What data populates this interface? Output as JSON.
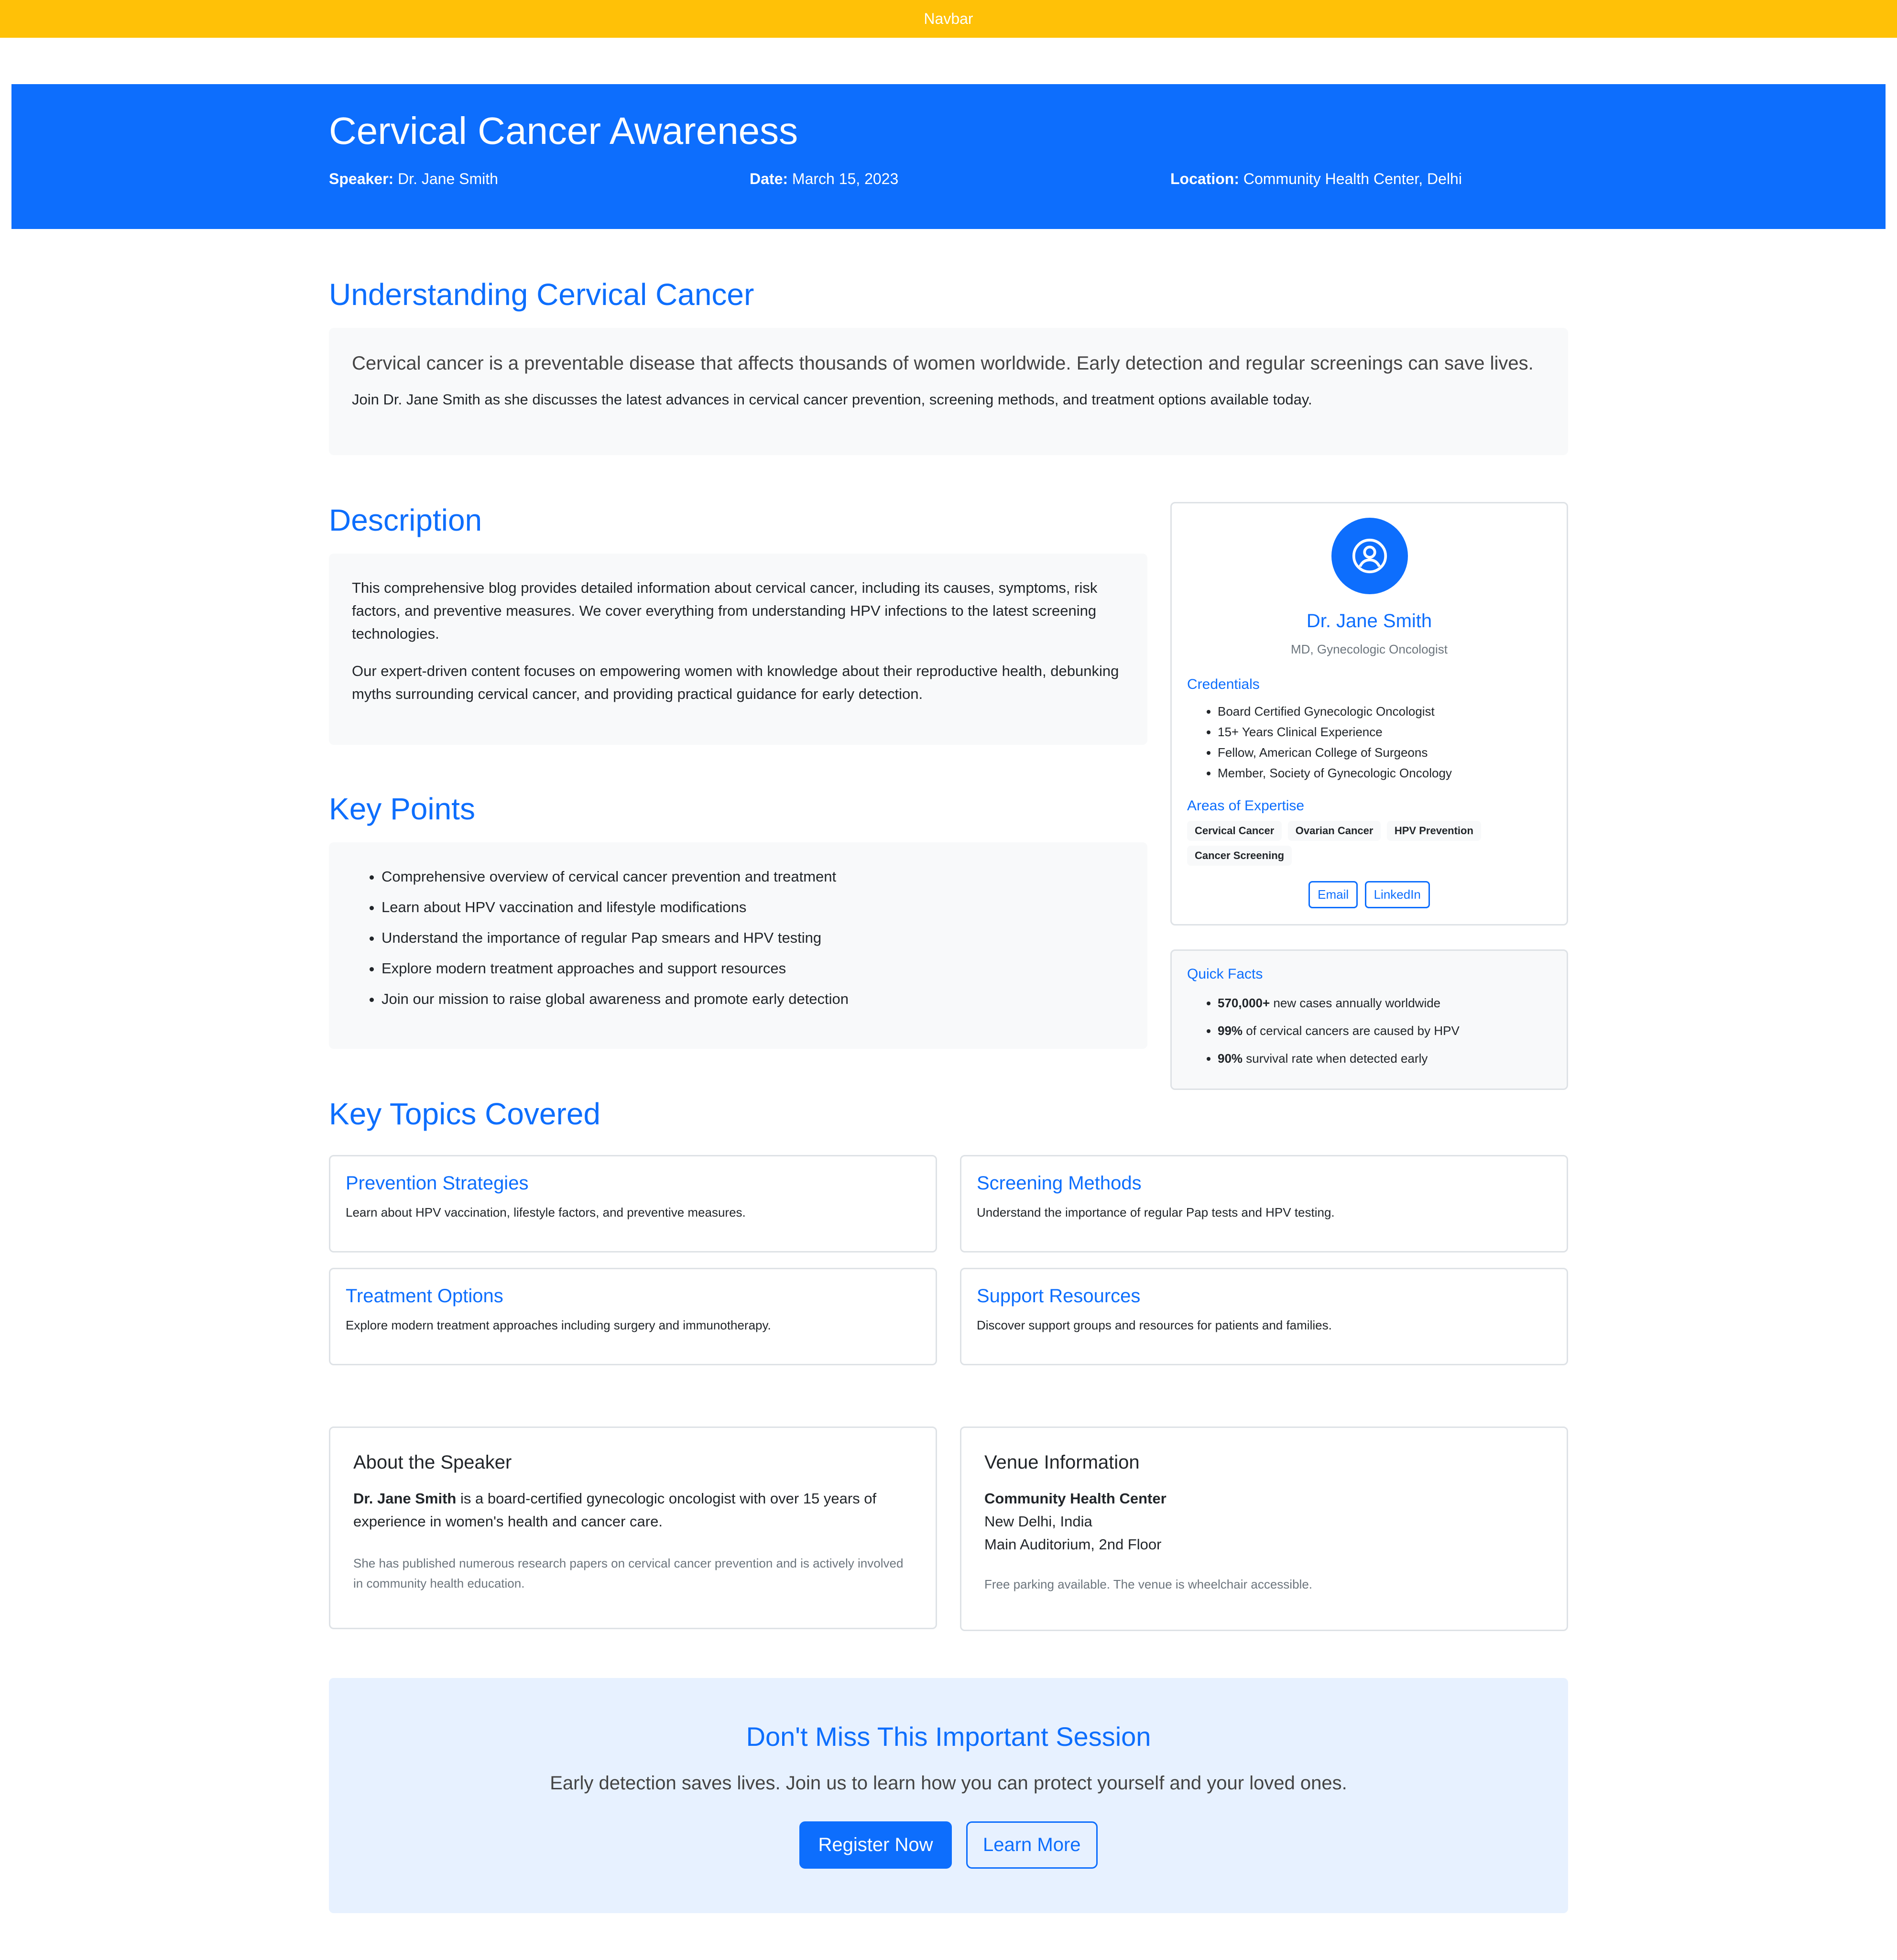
{
  "navbar": {
    "label": "Navbar"
  },
  "hero": {
    "title": "Cervical Cancer Awareness",
    "speaker_label": "Speaker:",
    "speaker": "Dr. Jane Smith",
    "date_label": "Date:",
    "date": "March 15, 2023",
    "location_label": "Location:",
    "location": "Community Health Center, Delhi"
  },
  "understanding": {
    "title": "Understanding Cervical Cancer",
    "lead": "Cervical cancer is a preventable disease that affects thousands of women worldwide. Early detection and regular screenings can save lives.",
    "text": "Join Dr. Jane Smith as she discusses the latest advances in cervical cancer prevention, screening methods, and treatment options available today."
  },
  "description": {
    "title": "Description",
    "p1": "This comprehensive blog provides detailed information about cervical cancer, including its causes, symptoms, risk factors, and preventive measures. We cover everything from understanding HPV infections to the latest screening technologies.",
    "p2": "Our expert-driven content focuses on empowering women with knowledge about their reproductive health, debunking myths surrounding cervical cancer, and providing practical guidance for early detection."
  },
  "key_points": {
    "title": "Key Points",
    "items": [
      "Comprehensive overview of cervical cancer prevention and treatment",
      "Learn about HPV vaccination and lifestyle modifications",
      "Understand the importance of regular Pap smears and HPV testing",
      "Explore modern treatment approaches and support resources",
      "Join our mission to raise global awareness and promote early detection"
    ]
  },
  "profile": {
    "icon": "user-circle-icon",
    "name": "Dr. Jane Smith",
    "subtitle": "MD, Gynecologic Oncologist",
    "credentials_title": "Credentials",
    "credentials": [
      "Board Certified Gynecologic Oncologist",
      "15+ Years Clinical Experience",
      "Fellow, American College of Surgeons",
      "Member, Society of Gynecologic Oncology"
    ],
    "expertise_title": "Areas of Expertise",
    "expertise": [
      "Cervical Cancer",
      "Ovarian Cancer",
      "HPV Prevention",
      "Cancer Screening"
    ],
    "email_label": "Email",
    "linkedin_label": "LinkedIn"
  },
  "quick_facts": {
    "title": "Quick Facts",
    "items": [
      {
        "strong": "570,000+",
        "text": " new cases annually worldwide"
      },
      {
        "strong": "99%",
        "text": " of cervical cancers are caused by HPV"
      },
      {
        "strong": "90%",
        "text": " survival rate when detected early"
      }
    ]
  },
  "topics": {
    "title": "Key Topics Covered",
    "items": [
      {
        "title": "Prevention Strategies",
        "text": "Learn about HPV vaccination, lifestyle factors, and preventive measures."
      },
      {
        "title": "Screening Methods",
        "text": "Understand the importance of regular Pap tests and HPV testing."
      },
      {
        "title": "Treatment Options",
        "text": "Explore modern treatment approaches including surgery and immunotherapy."
      },
      {
        "title": "Support Resources",
        "text": "Discover support groups and resources for patients and families."
      }
    ]
  },
  "about": {
    "title": "About the Speaker",
    "name": "Dr. Jane Smith",
    "text": " is a board-certified gynecologic oncologist with over 15 years of experience in women's health and cancer care.",
    "muted": "She has published numerous research papers on cervical cancer prevention and is actively involved in community health education."
  },
  "venue": {
    "title": "Venue Information",
    "name": "Community Health Center",
    "city": "New Delhi, India",
    "room": "Main Auditorium, 2nd Floor",
    "muted": "Free parking available. The venue is wheelchair accessible."
  },
  "cta": {
    "title": "Don't Miss This Important Session",
    "text": "Early detection saves lives. Join us to learn how you can protect yourself and your loved ones.",
    "register_label": "Register Now",
    "learn_label": "Learn More"
  },
  "colors": {
    "navbar": "#FFC107",
    "primary": "#0D6EFD",
    "panel": "#F8F9FA",
    "cta_bg": "#E7F1FF",
    "muted": "#6C757D"
  }
}
